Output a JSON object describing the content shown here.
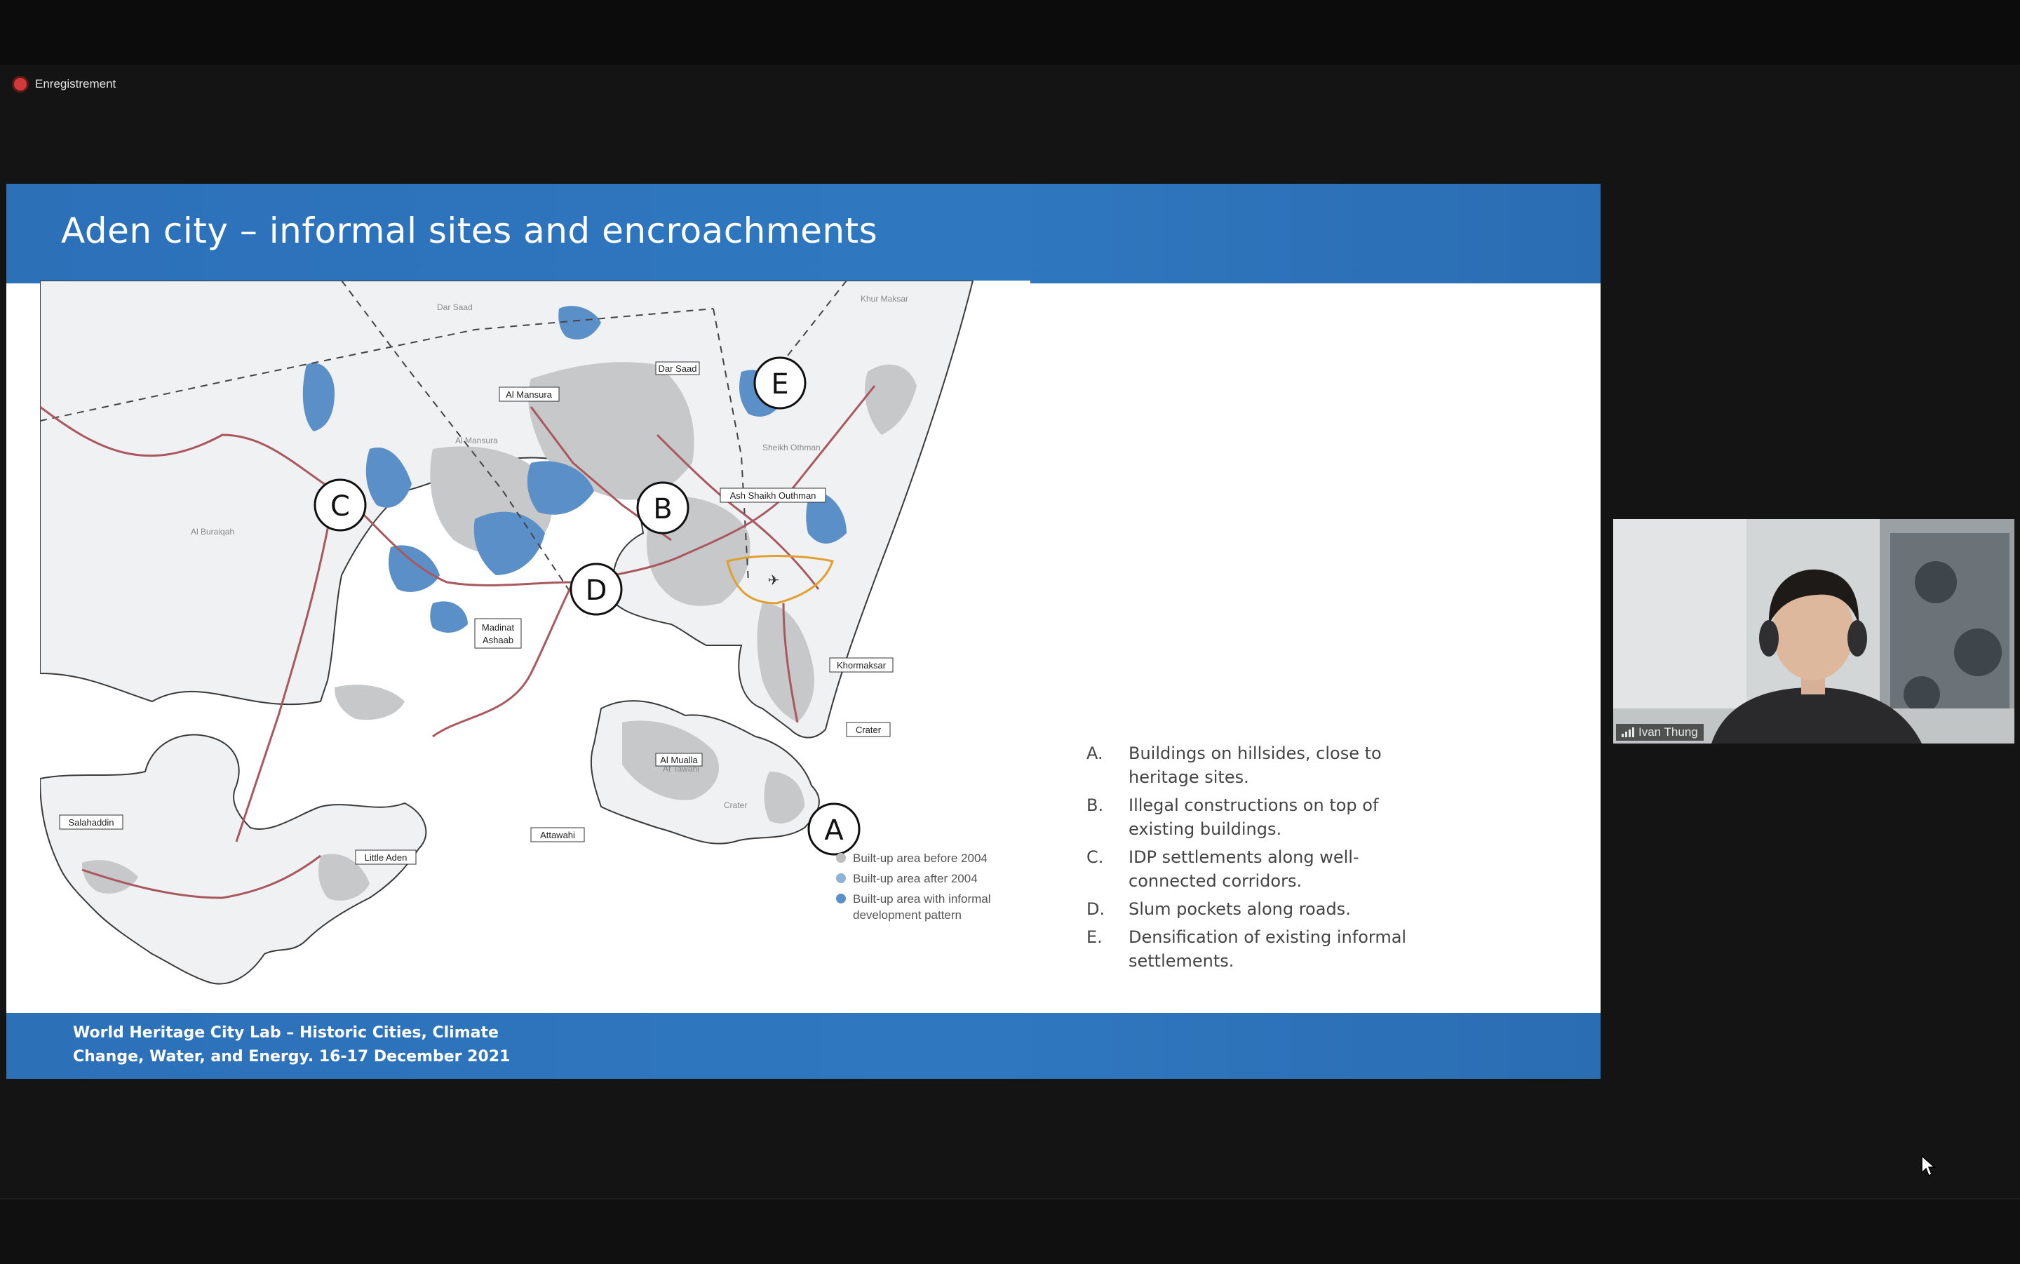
{
  "recording": {
    "label": "Enregistrement",
    "color": "#d23a3a"
  },
  "slide": {
    "title": "Aden city – informal sites and encroachments",
    "accent": "#2e74bc",
    "footer_line1": "World Heritage City Lab – Historic Cities, Climate",
    "footer_line2": "Change, Water, and Energy. 16-17 December 2021"
  },
  "map": {
    "markers": [
      "A",
      "B",
      "C",
      "D",
      "E"
    ],
    "place_labels": {
      "al_mansura_box": "Al Mansura",
      "dar_saad": "Dar Saad",
      "ash_shaikh": "Ash Shaikh Outhman",
      "madinat": "Madinat",
      "ashaab": "Ashaab",
      "khormaksar": "Khormaksar",
      "crater_box": "Crater",
      "al_mualla": "Al Mualla",
      "attawahi_box": "Attawahi",
      "salahaddin": "Salahaddin",
      "little_aden": "Little Aden",
      "dar_saad_grey": "Dar Saad",
      "khur_maksar_grey": "Khur Maksar",
      "al_mansura_grey": "Al Mansura",
      "sheikh_othman_grey": "Sheikh Othman",
      "al_buraiqah": "Al Buraiqah",
      "at_tawahi": "At Tawahi",
      "crater_grey": "Crater"
    },
    "legend": [
      {
        "text": "Built-up area before 2004",
        "color": "#bdbdbd"
      },
      {
        "text": "Built-up area after 2004",
        "color": "#8fb3d6"
      },
      {
        "text": "Built-up area with informal",
        "color": "#5b8fc7"
      },
      {
        "text": "development pattern",
        "color": ""
      }
    ]
  },
  "findings": [
    {
      "key": "A.",
      "text": "Buildings on hillsides, close to heritage sites."
    },
    {
      "key": "B.",
      "text": "Illegal constructions on top of existing buildings."
    },
    {
      "key": "C.",
      "text": "IDP settlements along well-connected corridors."
    },
    {
      "key": "D.",
      "text": "Slum pockets along roads."
    },
    {
      "key": "E.",
      "text": "Densification of existing informal settlements."
    }
  ],
  "participant": {
    "name": "Ivan Thung"
  }
}
